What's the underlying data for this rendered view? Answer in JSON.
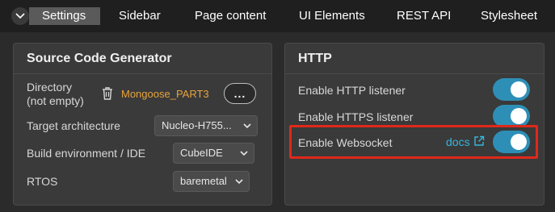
{
  "tabs": {
    "items": [
      {
        "label": "Settings"
      },
      {
        "label": "Sidebar"
      },
      {
        "label": "Page content"
      },
      {
        "label": "UI Elements"
      },
      {
        "label": "REST API"
      },
      {
        "label": "Stylesheet"
      }
    ],
    "active_index": 0,
    "collapse_icon": "chevron-down-icon"
  },
  "source_code_generator": {
    "title": "Source Code Generator",
    "directory_label_line1": "Directory",
    "directory_label_line2": "(not empty)",
    "directory_value": "Mongoose_PART3",
    "delete_icon": "trash-icon",
    "more_button_label": "...",
    "target_arch_label": "Target architecture",
    "target_arch_value": "Nucleo-H755...",
    "build_env_label": "Build environment / IDE",
    "build_env_value": "CubeIDE",
    "rtos_label": "RTOS",
    "rtos_value": "baremetal"
  },
  "http": {
    "title": "HTTP",
    "http_listener_label": "Enable HTTP listener",
    "http_listener_on": true,
    "https_listener_label": "Enable HTTPS listener",
    "https_listener_on": true,
    "websocket_label": "Enable Websocket",
    "websocket_on": true,
    "docs_link_label": "docs",
    "docs_icon": "external-link-icon"
  },
  "colors": {
    "accent_toggle": "#2e8fb6",
    "link": "#35b6df",
    "directory_value": "#e8a33d",
    "highlight": "#e0281a"
  }
}
